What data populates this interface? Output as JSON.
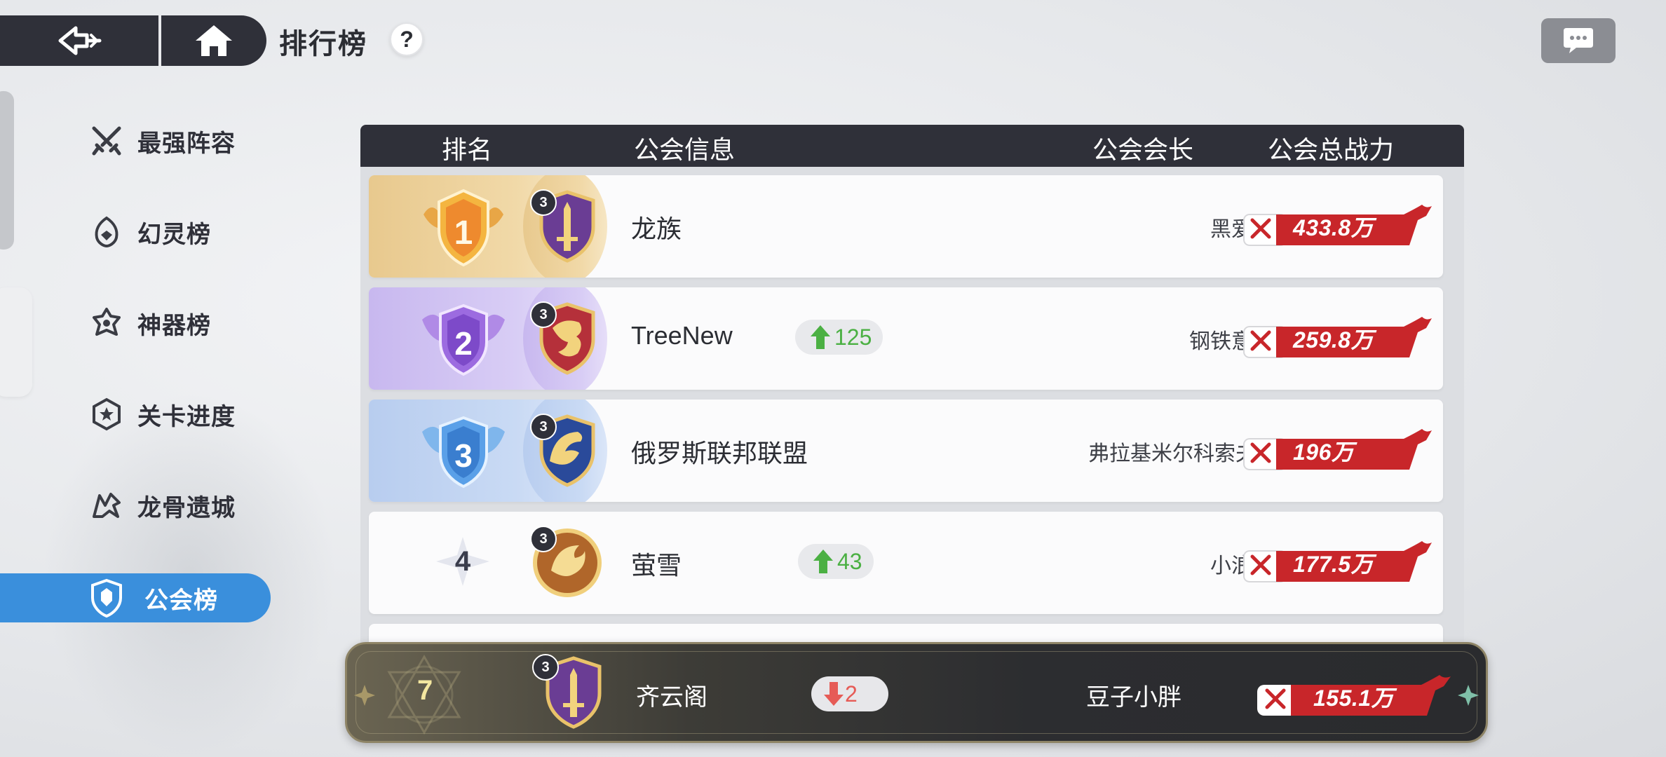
{
  "header": {
    "title": "排行榜",
    "help_label": "?"
  },
  "sidebar": {
    "items": [
      {
        "label": "最强阵容",
        "icon": "crossed-swords-icon"
      },
      {
        "label": "幻灵榜",
        "icon": "spirit-icon"
      },
      {
        "label": "神器榜",
        "icon": "artifact-icon"
      },
      {
        "label": "关卡进度",
        "icon": "star-badge-icon"
      },
      {
        "label": "龙骨遗城",
        "icon": "dragon-icon"
      },
      {
        "label": "公会榜",
        "icon": "guild-shield-icon",
        "active": true
      }
    ]
  },
  "table": {
    "columns": [
      "排名",
      "公会信息",
      "公会会长",
      "公会总战力"
    ],
    "rows": [
      {
        "rank": "1",
        "level": "3",
        "name": "龙族",
        "change": "",
        "leader": "黑爱",
        "power": "433.8万"
      },
      {
        "rank": "2",
        "level": "3",
        "name": "TreeNew",
        "change": "125",
        "leader": "钢铁意志",
        "power": "259.8万"
      },
      {
        "rank": "3",
        "level": "3",
        "name": "俄罗斯联邦联盟",
        "change": "",
        "leader": "弗拉基米尔科索夫",
        "power": "196万"
      },
      {
        "rank": "4",
        "level": "3",
        "name": "萤雪",
        "change": "43",
        "leader": "小浪",
        "power": "177.5万"
      }
    ]
  },
  "my_guild": {
    "rank": "7",
    "level": "3",
    "name": "齐云阁",
    "change": "2",
    "leader": "豆子小胖",
    "power": "155.1万"
  },
  "colors": {
    "dark": "#2f3039",
    "active_tab": "#3a8fdc",
    "power_red": "#c8262a",
    "rank_up": "#4bb043",
    "rank_down": "#e65b56"
  }
}
